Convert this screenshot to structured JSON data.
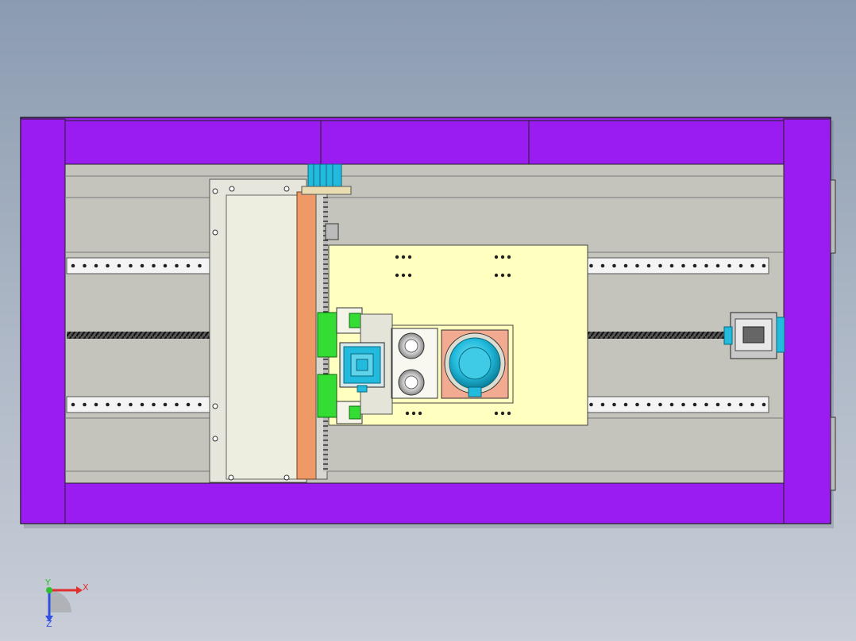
{
  "viewer": {
    "background_top": "#8b9bb1",
    "background_bottom": "#c9ced8"
  },
  "model": {
    "frame_color": "#9a1cf0",
    "base_color": "#c4c4bc",
    "carriage_color": "#ffffc0",
    "cover_color": "#eeeee0",
    "belt_color": "#ee9966",
    "motor_color": "#22bbdd",
    "block_color": "#33dd33",
    "plate_color": "#f2aa90"
  },
  "triad": {
    "x_label": "X",
    "y_label": "Y",
    "z_label": "Z",
    "x_color": "#e03030",
    "y_color": "#30c030",
    "z_color": "#3050e0"
  }
}
